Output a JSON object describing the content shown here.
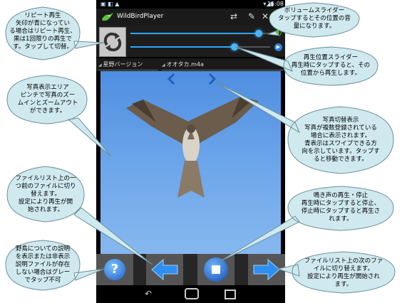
{
  "app": {
    "title": "WildBirdPlayer",
    "status_time": "15:08",
    "folder_select": "星野バージョン",
    "file_select": "オオタカ.m4a"
  },
  "icons": {
    "app_logo": "bird-logo-icon",
    "repeat": "repeat-icon",
    "shuffle": "shuffle-icon",
    "settings": "wrench-icon",
    "close": "close-icon",
    "menu": "overflow-menu-icon",
    "volume": "speaker-icon",
    "position": "play-small-icon",
    "photo_prev": "chevron-left-icon",
    "photo_next": "chevron-right-icon",
    "help": "help-icon",
    "prev_file": "arrow-left-icon",
    "stop": "stop-icon",
    "next_file": "arrow-right-icon",
    "nav_back": "back-icon",
    "nav_home": "home-icon",
    "nav_recent": "recent-apps-icon"
  },
  "sliders": {
    "volume_fraction": 0.94,
    "position_fraction": 0.76
  },
  "callouts": {
    "repeat": [
      "リピート再生",
      "矢印が青になってい",
      "る場合はリピート再生、",
      "黒は1回限りの再生で",
      "す。タップして切替。"
    ],
    "volume": [
      "ボリュームスライダー",
      "タップするとその位置の音",
      "量になります。"
    ],
    "position": [
      "再生位置スライダー",
      "再生時にタップすると、その",
      "位置から再生します。"
    ],
    "photo": [
      "写真表示エリア",
      "ピンチで写真のズー",
      "ムインとズームアウト",
      "ができます。"
    ],
    "photo_switch": [
      "写真切替表示",
      "写真が複数登録されている",
      "場合に表示されます。",
      "青表示はスワイプできる方",
      "向を示しています。タップす",
      "ると移動できます。"
    ],
    "prev_file": [
      "ファイルリスト上の一",
      "つ前のファイルに切り",
      "替えます。",
      "設定により再生が開",
      "始されます。"
    ],
    "play_stop": [
      "鳴き声の再生・停止",
      "再生時にタップすると停止、",
      "停止時にタップすると再生さ",
      "れます。"
    ],
    "help": [
      "野鳥についての説明",
      "を表示または非表示",
      "説明ファイルが存在",
      "しない場合はグレー",
      "でタップ不可"
    ],
    "next_file": [
      "ファイルリスト上の次のファ",
      "イルに切り替えます。",
      "設定により再生が開始され",
      "ます。"
    ]
  }
}
